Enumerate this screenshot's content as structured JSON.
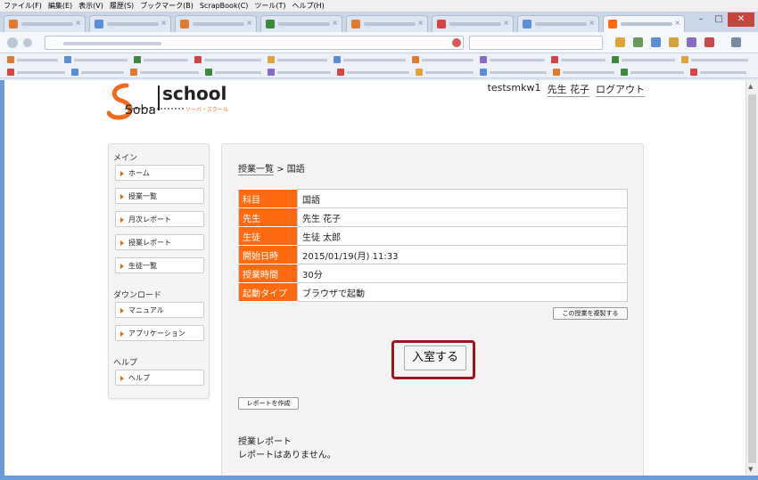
{
  "browser": {
    "menu": [
      "ファイル(F)",
      "編集(E)",
      "表示(V)",
      "履歴(S)",
      "ブックマーク(B)",
      "ScrapBook(C)",
      "ツール(T)",
      "ヘルプ(H)"
    ],
    "minimize_glyph": "–",
    "maximize_glyph": "□",
    "close_glyph": "✕",
    "tab_close_glyph": "×",
    "scroll_up_glyph": "▲",
    "scroll_down_glyph": "▼",
    "icons": [
      "back-icon",
      "forward-icon",
      "reload-icon",
      "home-icon",
      "bookmark-star-icon",
      "download-icon",
      "menu-icon"
    ]
  },
  "header": {
    "logo_main": "school",
    "logo_letters": "Soba",
    "logo_sub": "ソーバ・スクール",
    "username": "testsmkw1",
    "display_name": "先生 花子",
    "logout": "ログアウト"
  },
  "sidebar": {
    "main_title": "メイン",
    "main_items": [
      "ホーム",
      "授業一覧",
      "月次レポート",
      "授業レポート",
      "生徒一覧"
    ],
    "download_title": "ダウンロード",
    "download_items": [
      "マニュアル",
      "アプリケーション"
    ],
    "help_title": "ヘルプ",
    "help_items": [
      "ヘルプ"
    ]
  },
  "main": {
    "breadcrumb_link": "授業一覧",
    "breadcrumb_sep": ">",
    "breadcrumb_current": "国語",
    "details": [
      {
        "label": "科目",
        "value": "国語"
      },
      {
        "label": "先生",
        "value": "先生 花子"
      },
      {
        "label": "生徒",
        "value": "生徒 太郎"
      },
      {
        "label": "開始日時",
        "value": "2015/01/19(月) 11:33"
      },
      {
        "label": "授業時間",
        "value": "30分"
      },
      {
        "label": "起動タイプ",
        "value": "ブラウザで起動"
      }
    ],
    "copy_button": "この授業を複製する",
    "enter_button": "入室する",
    "create_report_button": "レポートを作成",
    "report_heading": "授業レポート",
    "report_empty": "レポートはありません。"
  },
  "colors": {
    "accent": "#ff6a10",
    "highlight": "#a3151e"
  }
}
